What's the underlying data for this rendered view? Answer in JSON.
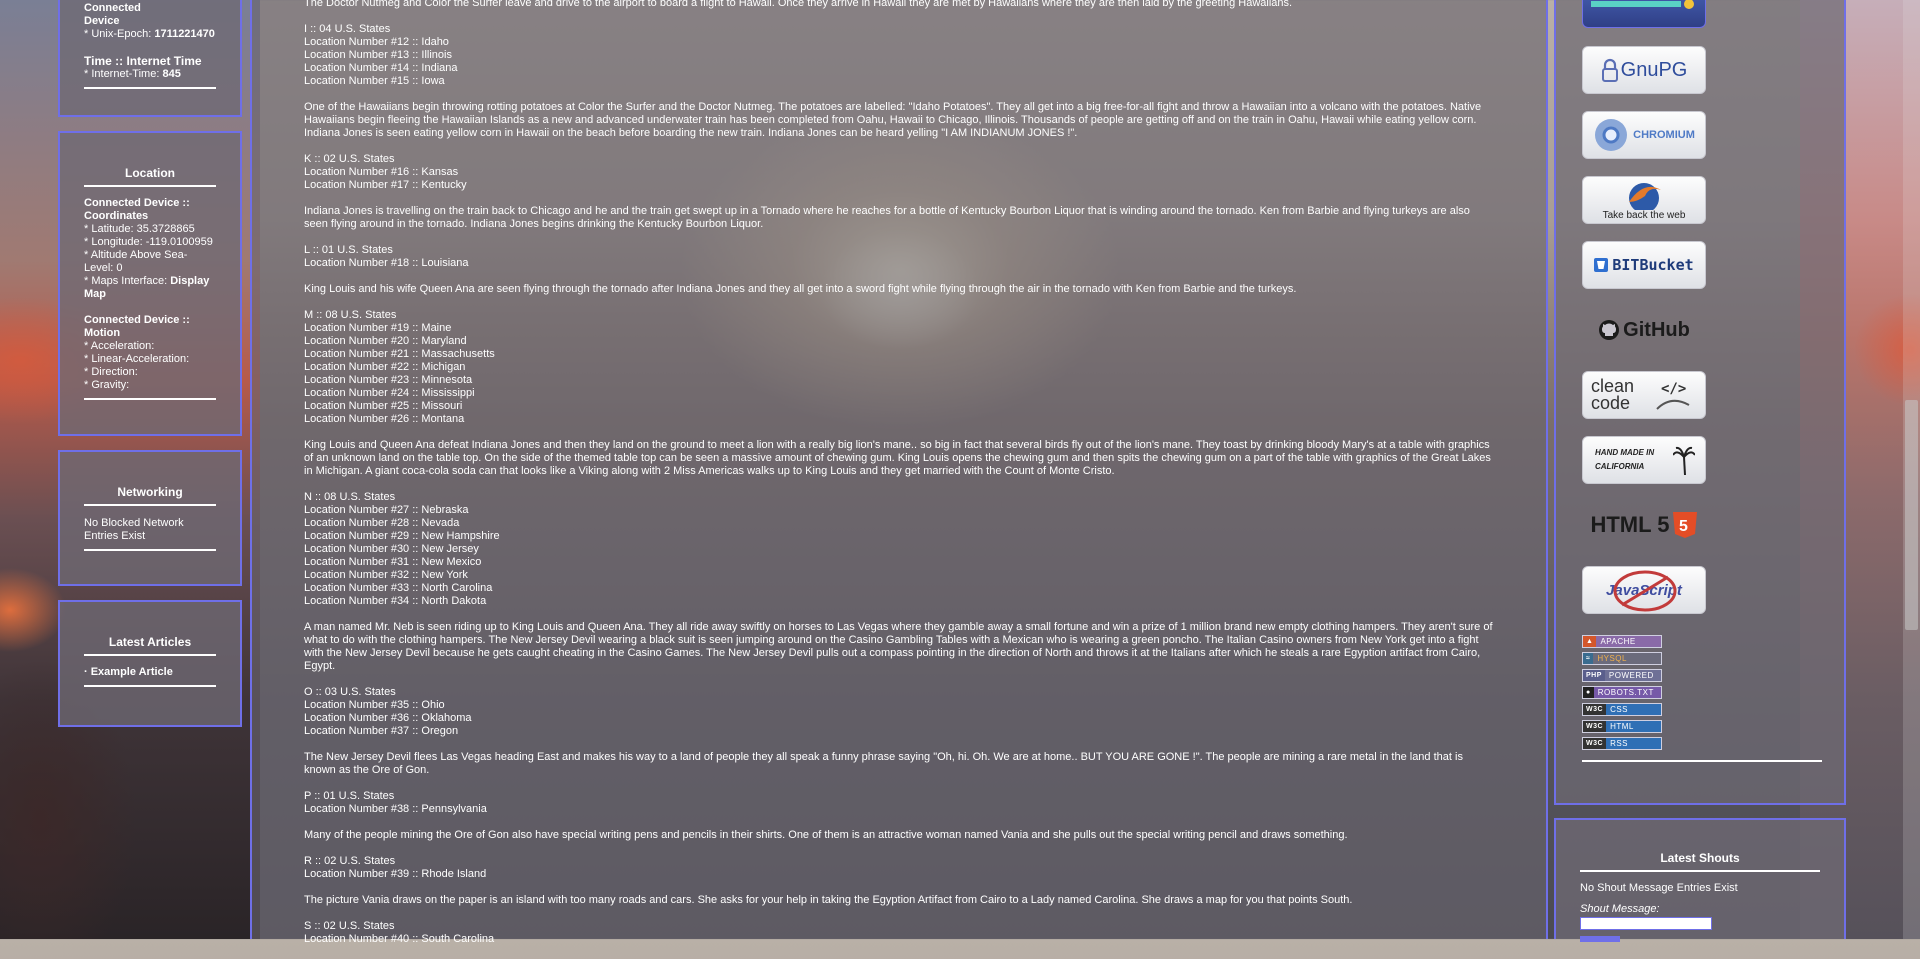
{
  "left": {
    "time_box": {
      "device_heading_top": "Connected",
      "device_heading": "Device",
      "unix_epoch_label": "* Unix-Epoch:",
      "unix_epoch_value": "1711221470",
      "internet_time_title": "Time :: Internet Time",
      "internet_time_label": "* Internet-Time:",
      "internet_time_value": "845"
    },
    "location_box": {
      "title": "Location",
      "coords_heading": "Connected Device :: Coordinates",
      "latitude": "* Latitude: 35.3728865",
      "longitude": "* Longitude: -119.0100959",
      "altitude": "* Altitude Above Sea-Level: 0",
      "maps_label": "* Maps Interface:",
      "maps_link": "Display Map",
      "motion_heading": "Connected Device :: Motion",
      "acceleration": "* Acceleration:",
      "linear_acceleration": "* Linear-Acceleration:",
      "direction": "* Direction:",
      "gravity": "* Gravity:"
    },
    "networking_box": {
      "title": "Networking",
      "text": "No Blocked Network Entries Exist"
    },
    "articles_box": {
      "title": "Latest Articles",
      "items": [
        "· Example Article"
      ]
    }
  },
  "main": {
    "intro": "The Doctor Nutmeg and Color the Surfer leave and drive to the airport to board a flight to Hawaii. Once they arrive in Hawaii they are met by Hawaiians where they are then laid by the greeting Hawaiians.",
    "sections": [
      {
        "heading": "I :: 04 U.S. States",
        "locations": [
          "Location Number #12 :: Idaho",
          "Location Number #13 :: Illinois",
          "Location Number #14 :: Indiana",
          "Location Number #15 :: Iowa"
        ],
        "story": "One of the Hawaiians begin throwing rotting potatoes at Color the Surfer and the Doctor Nutmeg. The potatoes are labelled: \"Idaho Potatoes\". They all get into a big free-for-all fight and throw a Hawaiian into a volcano with the potatoes. Native Hawaiians begin fleeing the Hawaiian Islands as a new and advanced underwater train has been completed from Oahu, Hawaii to Chicago, Illinois. Thousands of people are getting off and on the train in Oahu, Hawaii while eating yellow corn. Indiana Jones is seen eating yellow corn in Hawaii on the beach before boarding the new train. Indiana Jones can be heard yelling \"I AM INDIANUM JONES !\"."
      },
      {
        "heading": "K :: 02 U.S. States",
        "locations": [
          "Location Number #16 :: Kansas",
          "Location Number #17 :: Kentucky"
        ],
        "story": "Indiana Jones is travelling on the train back to Chicago and he and the train get swept up in a Tornado where he reaches for a bottle of Kentucky Bourbon Liquor that is winding around the tornado. Ken from Barbie and flying turkeys are also seen flying around in the tornado. Indiana Jones begins drinking the Kentucky Bourbon Liquor."
      },
      {
        "heading": "L :: 01 U.S. States",
        "locations": [
          "Location Number #18 :: Louisiana"
        ],
        "story": "King Louis and his wife Queen Ana are seen flying through the tornado after Indiana Jones and they all get into a sword fight while flying through the air in the tornado with Ken from Barbie and the turkeys."
      },
      {
        "heading": "M :: 08 U.S. States",
        "locations": [
          "Location Number #19 :: Maine",
          "Location Number #20 :: Maryland",
          "Location Number #21 :: Massachusetts",
          "Location Number #22 :: Michigan",
          "Location Number #23 :: Minnesota",
          "Location Number #24 :: Mississippi",
          "Location Number #25 :: Missouri",
          "Location Number #26 :: Montana"
        ],
        "story": "King Louis and Queen Ana defeat Indiana Jones and then they land on the ground to meet a lion with a really big lion's mane.. so big in fact that several birds fly out of the lion's mane. They toast by drinking bloody Mary's at a table with graphics of an unknown land on the table top. On the side of the themed table top can be seen a massive amount of chewing gum. King Louis opens the chewing gum and then spits the chewing gum on a part of the table with graphics of the Great Lakes in Michigan. A giant coca-cola soda can that looks like a Viking along with 2 Miss Americas walks up to King Louis and they get married with the Count of Monte Cristo."
      },
      {
        "heading": "N :: 08 U.S. States",
        "locations": [
          "Location Number #27 :: Nebraska",
          "Location Number #28 :: Nevada",
          "Location Number #29 :: New Hampshire",
          "Location Number #30 :: New Jersey",
          "Location Number #31 :: New Mexico",
          "Location Number #32 :: New York",
          "Location Number #33 :: North Carolina",
          "Location Number #34 :: North Dakota"
        ],
        "story": "A man named Mr. Neb is seen riding up to King Louis and Queen Ana. They all ride away swiftly on horses to Las Vegas where they gamble away a small fortune and win a prize of 1 million brand new empty clothing hampers. They aren't sure of what to do with the clothing hampers. The New Jersey Devil wearing a black suit is seen jumping around on the Casino Gambling Tables with a Mexican who is wearing a green poncho. The Italian Casino owners from New York get into a fight with the New Jersey Devil because he gets caught cheating in the Casino Games. The New Jersey Devil pulls out a compass pointing in the direction of North and throws it at the Italians after which he steals a rare Egyption artifact from Cairo, Egypt."
      },
      {
        "heading": "O :: 03 U.S. States",
        "locations": [
          "Location Number #35 :: Ohio",
          "Location Number #36 :: Oklahoma",
          "Location Number #37 :: Oregon"
        ],
        "story": "The New Jersey Devil flees Las Vegas heading East and makes his way to a land of people they all speak a funny phrase saying \"Oh, hi. Oh. We are at home.. BUT YOU ARE GONE !\". The people are mining a rare metal in the land that is known as the Ore of Gon."
      },
      {
        "heading": "P :: 01 U.S. States",
        "locations": [
          "Location Number #38 :: Pennsylvania"
        ],
        "story": "Many of the people mining the Ore of Gon also have special writing pens and pencils in their shirts. One of them is an attractive woman named Vania and she pulls out the special writing pencil and draws something."
      },
      {
        "heading": "R :: 02 U.S. States",
        "locations": [
          "Location Number #39 :: Rhode Island"
        ],
        "story": "The picture Vania draws on the paper is an island with too many roads and cars. She asks for your help in taking the Egyption Artifact from Cairo to a Lady named Carolina. She draws a map for you that points South."
      },
      {
        "heading": "S :: 02 U.S. States",
        "locations": [
          "Location Number #40 :: South Carolina"
        ],
        "story": ""
      }
    ]
  },
  "right": {
    "badges": [
      {
        "name": "gnupg",
        "label": "GnuPG"
      },
      {
        "name": "chromium",
        "label": "CHROMIUM"
      },
      {
        "name": "firefox",
        "label": "Take back the web"
      },
      {
        "name": "bitbucket",
        "label": "BITBucket"
      },
      {
        "name": "github",
        "label": "GitHub"
      },
      {
        "name": "clean-code",
        "label": "clean code"
      },
      {
        "name": "hand-made",
        "label": "HAND MADE IN CALIFORNIA"
      },
      {
        "name": "html5",
        "label": "HTML 5"
      },
      {
        "name": "javascript",
        "label": "JavaScript"
      }
    ],
    "mini_badges": [
      {
        "tag": "",
        "text": "APACHE"
      },
      {
        "tag": "",
        "text": "HYSQL"
      },
      {
        "tag": "PHP",
        "text": "POWERED"
      },
      {
        "tag": "",
        "text": "ROBOTS.TXT"
      },
      {
        "tag": "W3C",
        "text": "CSS"
      },
      {
        "tag": "W3C",
        "text": "HTML"
      },
      {
        "tag": "W3C",
        "text": "RSS"
      }
    ],
    "shouts": {
      "title": "Latest Shouts",
      "empty_text": "No Shout Message Entries Exist",
      "message_label": "Shout Message:",
      "input_value": ""
    }
  }
}
